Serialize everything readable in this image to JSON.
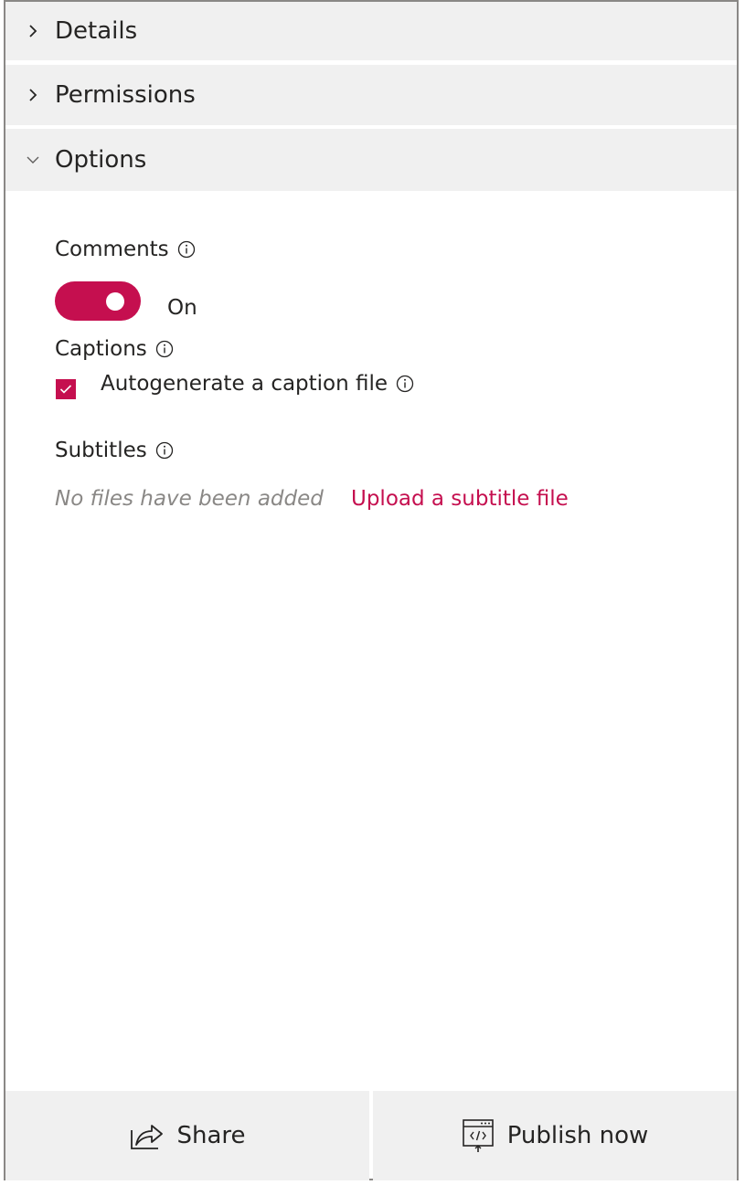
{
  "accordion": {
    "details": {
      "label": "Details",
      "expanded": false,
      "icon": "chevron-right-icon"
    },
    "permissions": {
      "label": "Permissions",
      "expanded": false,
      "icon": "chevron-right-icon"
    },
    "options": {
      "label": "Options",
      "expanded": true,
      "icon": "chevron-down-icon"
    }
  },
  "options": {
    "comments": {
      "label": "Comments",
      "info_icon": "info-icon",
      "toggle_state": "On",
      "toggle_on": true
    },
    "captions": {
      "label": "Captions",
      "info_icon": "info-icon",
      "checkbox_label": "Autogenerate a caption file",
      "checked": true
    },
    "subtitles": {
      "label": "Subtitles",
      "info_icon": "info-icon",
      "empty_text": "No files have been added",
      "upload_link": "Upload a subtitle file"
    }
  },
  "footer": {
    "share_label": "Share",
    "share_icon": "share-icon",
    "publish_label": "Publish now",
    "publish_icon": "publish-icon"
  },
  "colors": {
    "accent": "#c50f4f",
    "header_bg": "#f0f0f0",
    "muted_text": "#8a8886"
  }
}
